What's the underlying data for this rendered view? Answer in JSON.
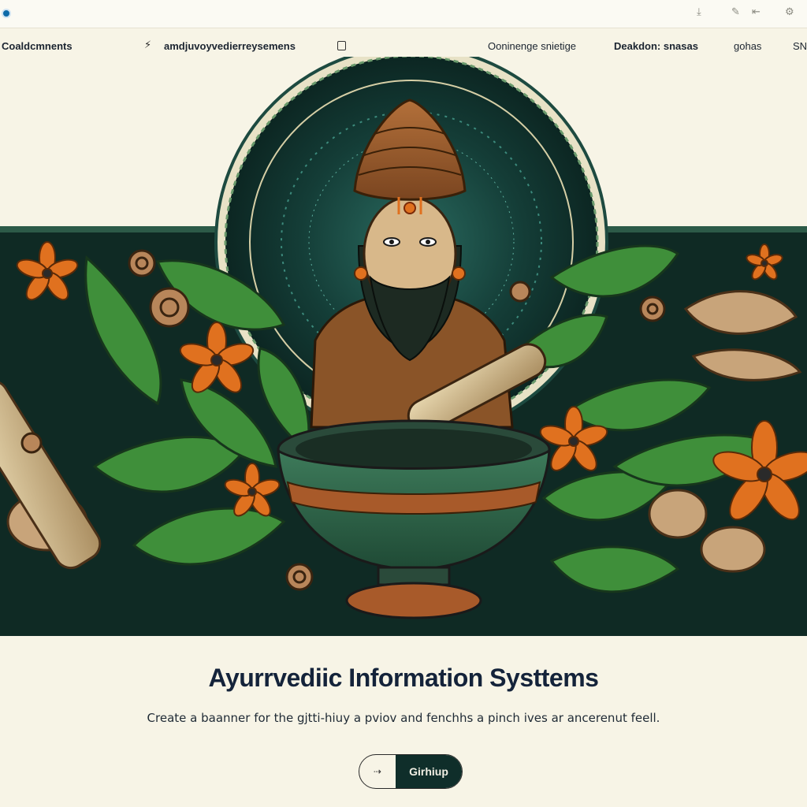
{
  "browser": {
    "controls": [
      "⤓",
      "✎",
      "⇤",
      "⚙"
    ]
  },
  "nav": {
    "brand": "Coaldcmnents",
    "subtitle": "amdjuvoyvedierreysemens",
    "link_1": "Ooninenge snietige",
    "link_2": "Deakdon: snasas",
    "link_3": "gohas",
    "link_4": "SN"
  },
  "hero": {
    "title": "Ayurrvediic Information Systtems",
    "description": "Create a baanner for the gjtti-hiuy a pviov and fenchhs a pinch ives ar ancerenut feell."
  },
  "cta": {
    "icon_label": "⇢",
    "label": "Girhiup"
  },
  "colors": {
    "background": "#f7f4e6",
    "band_dark": "#0f2a24",
    "leaf_green": "#3f8f3a",
    "halo_teal": "#1f5d52",
    "flower_orange": "#e0711f",
    "button_dark": "#0f2e2a"
  },
  "icons": [
    "browser-logo-icon",
    "download-icon",
    "edit-icon",
    "back-icon",
    "settings-icon",
    "run-icon",
    "doc-icon"
  ]
}
